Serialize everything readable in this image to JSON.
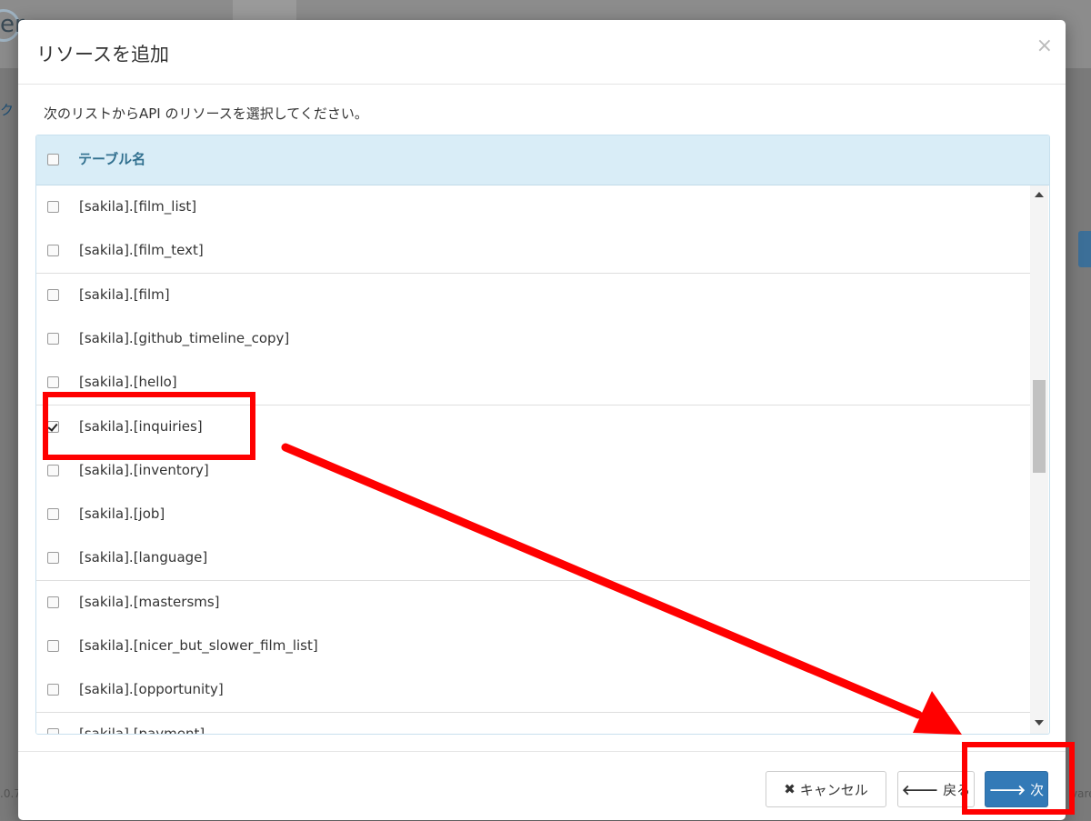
{
  "background": {
    "logo_fragment": "er",
    "side_fragment": "ク",
    "version_fragment": ".0.7",
    "footer_fragment": "vare"
  },
  "modal": {
    "title": "リソースを追加",
    "close_symbol": "×",
    "instruction": "次のリストからAPI のリソースを選択してください。",
    "table": {
      "header_label": "テーブル名",
      "rows": [
        {
          "name": "[sakila].[film_list]",
          "checked": false
        },
        {
          "name": "[sakila].[film_text]",
          "checked": false
        },
        {
          "name": "[sakila].[film]",
          "checked": false
        },
        {
          "name": "[sakila].[github_timeline_copy]",
          "checked": false
        },
        {
          "name": "[sakila].[hello]",
          "checked": false
        },
        {
          "name": "[sakila].[inquiries]",
          "checked": true
        },
        {
          "name": "[sakila].[inventory]",
          "checked": false
        },
        {
          "name": "[sakila].[job]",
          "checked": false
        },
        {
          "name": "[sakila].[language]",
          "checked": false
        },
        {
          "name": "[sakila].[mastersms]",
          "checked": false
        },
        {
          "name": "[sakila].[nicer_but_slower_film_list]",
          "checked": false
        },
        {
          "name": "[sakila].[opportunity]",
          "checked": false
        },
        {
          "name": "[sakila].[payment]",
          "checked": false
        }
      ]
    },
    "footer": {
      "cancel_label": "キャンセル",
      "back_label": "戻る",
      "next_label": "次"
    }
  },
  "colors": {
    "header_bg": "#d9edf7",
    "header_text": "#31708f",
    "primary": "#337ab7",
    "annotation": "#ff0000"
  }
}
